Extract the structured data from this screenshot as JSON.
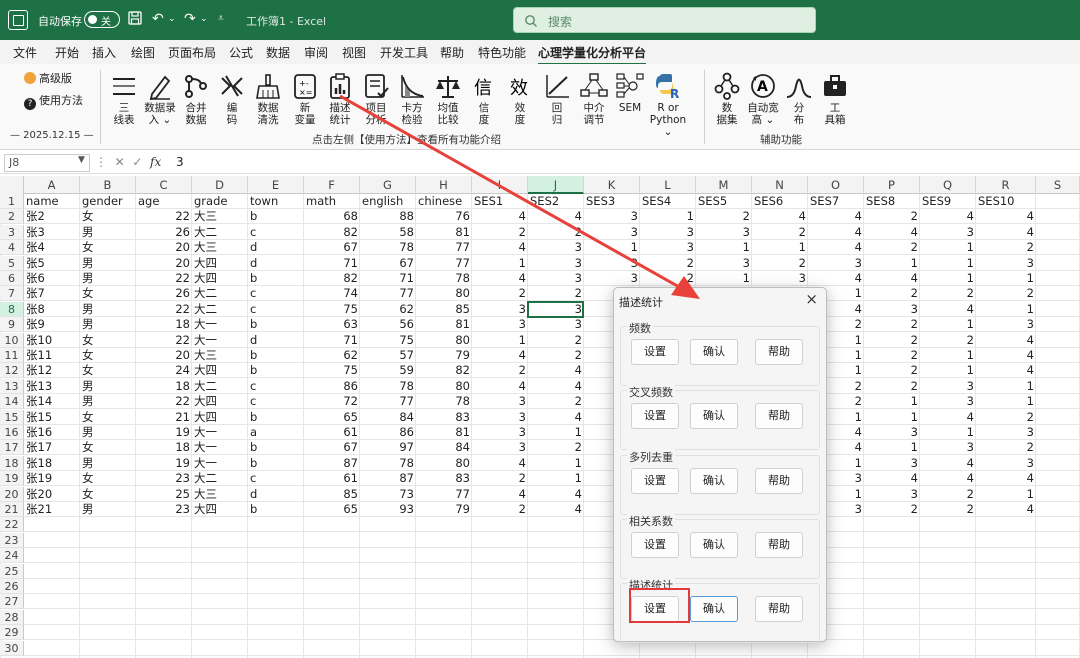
{
  "titlebar": {
    "autosave_label": "自动保存",
    "autosave_state": "关",
    "doc_title": "工作簿1 - Excel",
    "search_placeholder": "搜索"
  },
  "menu": [
    "文件",
    "开始",
    "插入",
    "绘图",
    "页面布局",
    "公式",
    "数据",
    "审阅",
    "视图",
    "开发工具",
    "帮助",
    "特色功能",
    "心理学量化分析平台"
  ],
  "ribbon": {
    "advanced_label": "高级版",
    "help_label": "使用方法",
    "date_label": "— 2025.12.15 —",
    "buttons": [
      {
        "l1": "三",
        "l2": "线表",
        "icon": "three-line-table-icon"
      },
      {
        "l1": "数据录",
        "l2": "入 ⌄",
        "icon": "pen-icon"
      },
      {
        "l1": "合并",
        "l2": "数据",
        "icon": "merge-icon"
      },
      {
        "l1": "编",
        "l2": "码",
        "icon": "code-icon"
      },
      {
        "l1": "数据",
        "l2": "清洗",
        "icon": "broom-icon"
      },
      {
        "l1": "新",
        "l2": "变量",
        "icon": "calculator-icon"
      },
      {
        "l1": "描述",
        "l2": "统计",
        "icon": "clipboard-chart-icon"
      },
      {
        "l1": "项目",
        "l2": "分析",
        "icon": "checklist-icon"
      },
      {
        "l1": "卡方",
        "l2": "检验",
        "icon": "chi-curve-icon"
      },
      {
        "l1": "均值",
        "l2": "比较",
        "icon": "balance-icon"
      },
      {
        "l1": "信",
        "l2": "度",
        "icon": "xin-icon"
      },
      {
        "l1": "效",
        "l2": "度",
        "icon": "xiao-icon"
      },
      {
        "l1": "回",
        "l2": "归",
        "icon": "regression-icon"
      },
      {
        "l1": "中介",
        "l2": "调节",
        "icon": "mediation-icon"
      },
      {
        "l1": "SEM",
        "l2": "",
        "icon": "sem-icon"
      },
      {
        "l1": "R or",
        "l2": "Python ⌄",
        "icon": "python-icon"
      },
      {
        "l1": "数",
        "l2": "据集",
        "icon": "dataset-icon"
      },
      {
        "l1": "自动宽",
        "l2": "高 ⌄",
        "icon": "auto-size-icon"
      },
      {
        "l1": "分",
        "l2": "布",
        "icon": "distribution-icon"
      },
      {
        "l1": "工",
        "l2": "具箱",
        "icon": "toolbox-icon"
      }
    ],
    "group_main": "点击左侧【使用方法】查看所有功能介绍",
    "group_aux": "辅助功能"
  },
  "formula": {
    "namebox": "J8",
    "value": "3"
  },
  "columns": [
    "A",
    "B",
    "C",
    "D",
    "E",
    "F",
    "G",
    "H",
    "I",
    "J",
    "K",
    "L",
    "M",
    "N",
    "O",
    "P",
    "Q",
    "R",
    "S"
  ],
  "header_row": [
    "name",
    "gender",
    "age",
    "grade",
    "town",
    "math",
    "english",
    "chinese",
    "SES1",
    "SES2",
    "SES3",
    "SES4",
    "SES5",
    "SES6",
    "SES7",
    "SES8",
    "SES9",
    "SES10"
  ],
  "rows": [
    [
      "张2",
      "女",
      "22",
      "大三",
      "b",
      "68",
      "88",
      "76",
      "4",
      "4",
      "3",
      "1",
      "2",
      "4",
      "4",
      "2",
      "4",
      "4"
    ],
    [
      "张3",
      "男",
      "26",
      "大二",
      "c",
      "82",
      "58",
      "81",
      "2",
      "2",
      "3",
      "3",
      "3",
      "2",
      "4",
      "4",
      "3",
      "4"
    ],
    [
      "张4",
      "女",
      "20",
      "大三",
      "d",
      "67",
      "78",
      "77",
      "4",
      "3",
      "1",
      "3",
      "1",
      "1",
      "4",
      "2",
      "1",
      "2"
    ],
    [
      "张5",
      "男",
      "20",
      "大四",
      "d",
      "71",
      "67",
      "77",
      "1",
      "3",
      "3",
      "2",
      "3",
      "2",
      "3",
      "1",
      "1",
      "3"
    ],
    [
      "张6",
      "男",
      "22",
      "大四",
      "b",
      "82",
      "71",
      "78",
      "4",
      "3",
      "3",
      "2",
      "1",
      "3",
      "4",
      "4",
      "1",
      "1"
    ],
    [
      "张7",
      "女",
      "26",
      "大二",
      "c",
      "74",
      "77",
      "80",
      "2",
      "2",
      "",
      "",
      "",
      "",
      "1",
      "2",
      "2",
      "2"
    ],
    [
      "张8",
      "男",
      "22",
      "大二",
      "c",
      "75",
      "62",
      "85",
      "3",
      "3",
      "",
      "",
      "",
      "",
      "4",
      "3",
      "4",
      "1"
    ],
    [
      "张9",
      "男",
      "18",
      "大一",
      "b",
      "63",
      "56",
      "81",
      "3",
      "3",
      "",
      "",
      "",
      "",
      "2",
      "2",
      "1",
      "3"
    ],
    [
      "张10",
      "女",
      "22",
      "大一",
      "d",
      "71",
      "75",
      "80",
      "1",
      "2",
      "",
      "",
      "",
      "",
      "1",
      "2",
      "2",
      "4"
    ],
    [
      "张11",
      "女",
      "20",
      "大三",
      "b",
      "62",
      "57",
      "79",
      "4",
      "2",
      "",
      "",
      "",
      "",
      "1",
      "2",
      "1",
      "4"
    ],
    [
      "张12",
      "女",
      "24",
      "大四",
      "b",
      "75",
      "59",
      "82",
      "2",
      "4",
      "",
      "",
      "",
      "",
      "1",
      "2",
      "1",
      "4"
    ],
    [
      "张13",
      "男",
      "18",
      "大二",
      "c",
      "86",
      "78",
      "80",
      "4",
      "4",
      "",
      "",
      "",
      "",
      "2",
      "2",
      "3",
      "1"
    ],
    [
      "张14",
      "男",
      "22",
      "大四",
      "c",
      "72",
      "77",
      "78",
      "3",
      "2",
      "",
      "",
      "",
      "",
      "2",
      "1",
      "3",
      "1"
    ],
    [
      "张15",
      "女",
      "21",
      "大四",
      "b",
      "65",
      "84",
      "83",
      "3",
      "4",
      "",
      "",
      "",
      "",
      "1",
      "1",
      "4",
      "2"
    ],
    [
      "张16",
      "男",
      "19",
      "大一",
      "a",
      "61",
      "86",
      "81",
      "3",
      "1",
      "",
      "",
      "",
      "",
      "4",
      "3",
      "1",
      "3"
    ],
    [
      "张17",
      "女",
      "18",
      "大一",
      "b",
      "67",
      "97",
      "84",
      "3",
      "2",
      "",
      "",
      "",
      "",
      "4",
      "1",
      "3",
      "2"
    ],
    [
      "张18",
      "男",
      "19",
      "大一",
      "b",
      "87",
      "78",
      "80",
      "4",
      "1",
      "",
      "",
      "",
      "",
      "1",
      "3",
      "4",
      "3"
    ],
    [
      "张19",
      "女",
      "23",
      "大二",
      "c",
      "61",
      "87",
      "83",
      "2",
      "1",
      "",
      "",
      "",
      "",
      "3",
      "4",
      "4",
      "4"
    ],
    [
      "张20",
      "女",
      "25",
      "大三",
      "d",
      "85",
      "73",
      "77",
      "4",
      "4",
      "",
      "",
      "",
      "",
      "1",
      "3",
      "2",
      "1"
    ],
    [
      "张21",
      "男",
      "23",
      "大四",
      "b",
      "65",
      "93",
      "79",
      "2",
      "4",
      "",
      "",
      "",
      "",
      "3",
      "2",
      "2",
      "4"
    ]
  ],
  "row_numbers": [
    "1",
    "2",
    "3",
    "4",
    "5",
    "6",
    "7",
    "8",
    "9",
    "10",
    "11",
    "12",
    "13",
    "14",
    "15",
    "16",
    "17",
    "18",
    "19",
    "20",
    "21",
    "22",
    "23",
    "24",
    "25",
    "26",
    "27",
    "28",
    "29",
    "30"
  ],
  "dialog": {
    "title": "描述统计",
    "close": "×",
    "sections": [
      {
        "label": "频数",
        "buttons": [
          "设置",
          "确认",
          "帮助"
        ]
      },
      {
        "label": "交叉频数",
        "buttons": [
          "设置",
          "确认",
          "帮助"
        ]
      },
      {
        "label": "多列去重",
        "buttons": [
          "设置",
          "确认",
          "帮助"
        ]
      },
      {
        "label": "相关系数",
        "buttons": [
          "设置",
          "确认",
          "帮助"
        ]
      },
      {
        "label": "描述统计",
        "buttons": [
          "设置",
          "确认",
          "帮助"
        ]
      }
    ]
  },
  "colors": {
    "excel_green": "#1e7145",
    "highlight_red": "#e03a3a"
  }
}
